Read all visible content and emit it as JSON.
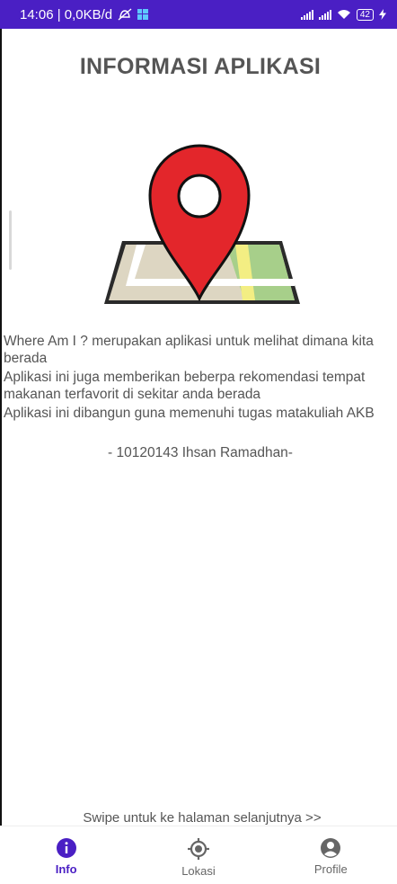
{
  "status_bar": {
    "time_net": "14:06 | 0,0KB/d",
    "battery": "42"
  },
  "page": {
    "title": "INFORMASI APLIKASI",
    "description": [
      "Where Am I ? merupakan aplikasi untuk melihat dimana kita berada",
      "Aplikasi ini juga memberikan beberpa rekomendasi tempat makanan terfavorit di sekitar anda berada",
      "Aplikasi ini dibangun guna memenuhi tugas matakuliah AKB"
    ],
    "author": "- 10120143 Ihsan Ramadhan-",
    "swipe_hint": "Swipe untuk ke halaman selanjutnya >>"
  },
  "bottom_nav": {
    "items": [
      {
        "label": "Info",
        "icon": "info-icon",
        "active": true
      },
      {
        "label": "Lokasi",
        "icon": "location-target-icon",
        "active": false
      },
      {
        "label": "Profile",
        "icon": "profile-icon",
        "active": false
      }
    ]
  },
  "colors": {
    "accent": "#4a1fc4",
    "pin": "#e3262b"
  }
}
